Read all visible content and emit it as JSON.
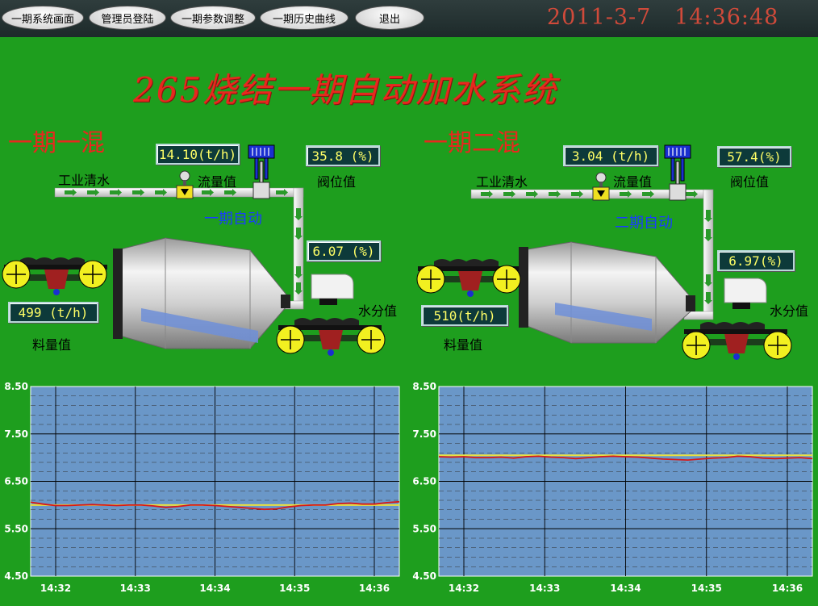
{
  "nav": {
    "buttons": [
      {
        "label": "一期系统画面"
      },
      {
        "label": "管理员登陆"
      },
      {
        "label": "一期参数调整"
      },
      {
        "label": "一期历史曲线"
      },
      {
        "label": "退出"
      }
    ],
    "date": "2011-3-7",
    "time": "14:36:48"
  },
  "title": "265烧结一期自动加水系统",
  "mixers": [
    {
      "name": "一期一混",
      "water_label": "工业清水",
      "flow_label": "流量值",
      "flow_value": "14.10(t/h)",
      "valve_label": "阀位值",
      "valve_value": "35.8 (%)",
      "mode_label": "一期自动",
      "moisture_value": "6.07 (%)",
      "moisture_label": "水分值",
      "material_value": "499 (t/h)",
      "material_label": "料量值"
    },
    {
      "name": "一期二混",
      "water_label": "工业清水",
      "flow_label": "流量值",
      "flow_value": "3.04 (t/h)",
      "valve_label": "阀位值",
      "valve_value": "57.4(%)",
      "mode_label": "二期自动",
      "moisture_value": "6.97(%)",
      "moisture_label": "水分值",
      "material_value": "510(t/h)",
      "material_label": "料量值"
    }
  ],
  "colors": {
    "background": "#1e9e1e",
    "chart_bg": "#6a97c8",
    "setpoint": "#e8e040",
    "actual": "#d81818",
    "title": "#e8281e",
    "datetime": "#d04a3a"
  },
  "chart_data": [
    {
      "type": "line",
      "ylim": [
        4.5,
        8.5
      ],
      "yticks": [
        "8.50",
        "7.50",
        "6.50",
        "5.50",
        "4.50"
      ],
      "xticks": [
        "14:32",
        "14:33",
        "14:34",
        "14:35",
        "14:36"
      ],
      "grid": true,
      "series": [
        {
          "color": "#e8e040",
          "y": [
            6.0,
            6.0,
            6.0,
            6.0,
            6.0,
            6.0,
            6.0,
            6.0,
            6.0,
            6.0,
            6.0,
            6.0,
            6.0,
            6.0,
            6.0,
            6.0,
            6.0,
            6.0,
            6.0,
            6.0,
            6.0,
            6.0,
            6.0,
            6.0,
            6.0,
            6.0,
            6.0,
            6.0,
            6.0,
            6.0,
            6.0
          ]
        },
        {
          "color": "#d81818",
          "y": [
            6.06,
            6.02,
            5.99,
            5.99,
            6.0,
            6.01,
            6.0,
            5.99,
            6.0,
            6.0,
            5.98,
            5.95,
            5.97,
            6.0,
            6.0,
            5.99,
            5.97,
            5.95,
            5.93,
            5.91,
            5.92,
            5.96,
            5.99,
            6.0,
            6.0,
            6.03,
            6.04,
            6.02,
            6.02,
            6.05,
            6.07
          ]
        }
      ]
    },
    {
      "type": "line",
      "ylim": [
        4.5,
        8.5
      ],
      "yticks": [
        "8.50",
        "7.50",
        "6.50",
        "5.50",
        "4.50"
      ],
      "xticks": [
        "14:32",
        "14:33",
        "14:34",
        "14:35",
        "14:36"
      ],
      "grid": true,
      "series": [
        {
          "color": "#e8e040",
          "y": [
            7.05,
            7.05,
            7.05,
            7.05,
            7.05,
            7.05,
            7.05,
            7.05,
            7.05,
            7.05,
            7.05,
            7.05,
            7.05,
            7.05,
            7.05,
            7.05,
            7.05,
            7.05,
            7.05,
            7.05,
            7.05,
            7.05,
            7.05,
            7.05,
            7.05,
            7.05,
            7.05,
            7.05,
            7.05,
            7.05,
            7.05
          ]
        },
        {
          "color": "#d81818",
          "y": [
            7.02,
            7.01,
            7.02,
            7.0,
            7.0,
            7.01,
            6.99,
            7.02,
            7.03,
            7.01,
            7.0,
            6.98,
            7.0,
            7.02,
            7.03,
            7.02,
            7.01,
            6.99,
            6.97,
            6.96,
            6.95,
            6.97,
            6.99,
            7.0,
            7.03,
            7.02,
            6.99,
            6.98,
            6.99,
            7.0,
            6.98
          ]
        }
      ]
    }
  ]
}
